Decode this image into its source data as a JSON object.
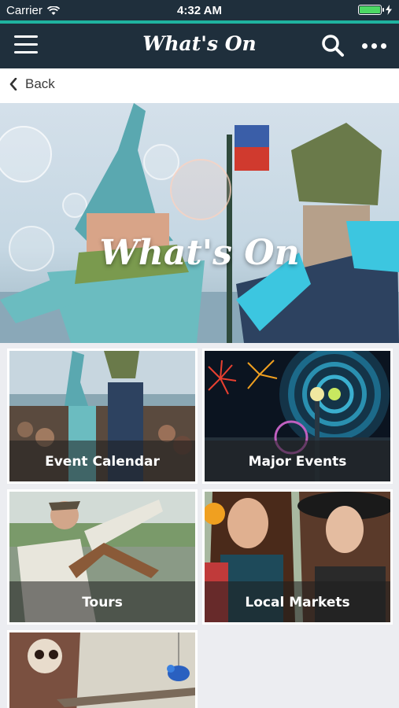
{
  "status_bar": {
    "carrier": "Carrier",
    "time": "4:32 AM",
    "battery_level": 1.0
  },
  "nav": {
    "title": "What's On",
    "icons": [
      "menu-icon",
      "search-icon",
      "more-icon"
    ]
  },
  "back": {
    "label": "Back"
  },
  "hero": {
    "title": "What's On"
  },
  "tiles": [
    {
      "label": "Event Calendar"
    },
    {
      "label": "Major Events"
    },
    {
      "label": "Tours"
    },
    {
      "label": "Local Markets"
    },
    {
      "label": ""
    }
  ],
  "colors": {
    "nav_bg": "#1f2f3c",
    "accent": "#1fb3a0",
    "page_bg": "#ecedf1"
  }
}
